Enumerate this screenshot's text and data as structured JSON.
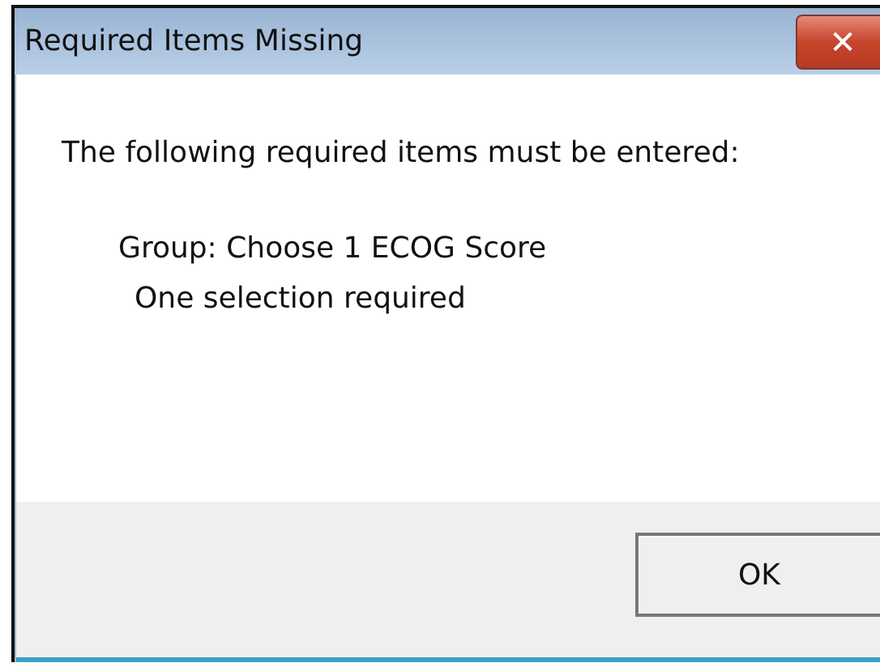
{
  "window": {
    "title": "Required Items Missing",
    "close": "✕"
  },
  "message": "The following required items must be entered:",
  "items": [
    {
      "group": "Group: Choose 1 ECOG Score",
      "requirement": "One selection required"
    }
  ],
  "buttons": [
    "OK"
  ]
}
